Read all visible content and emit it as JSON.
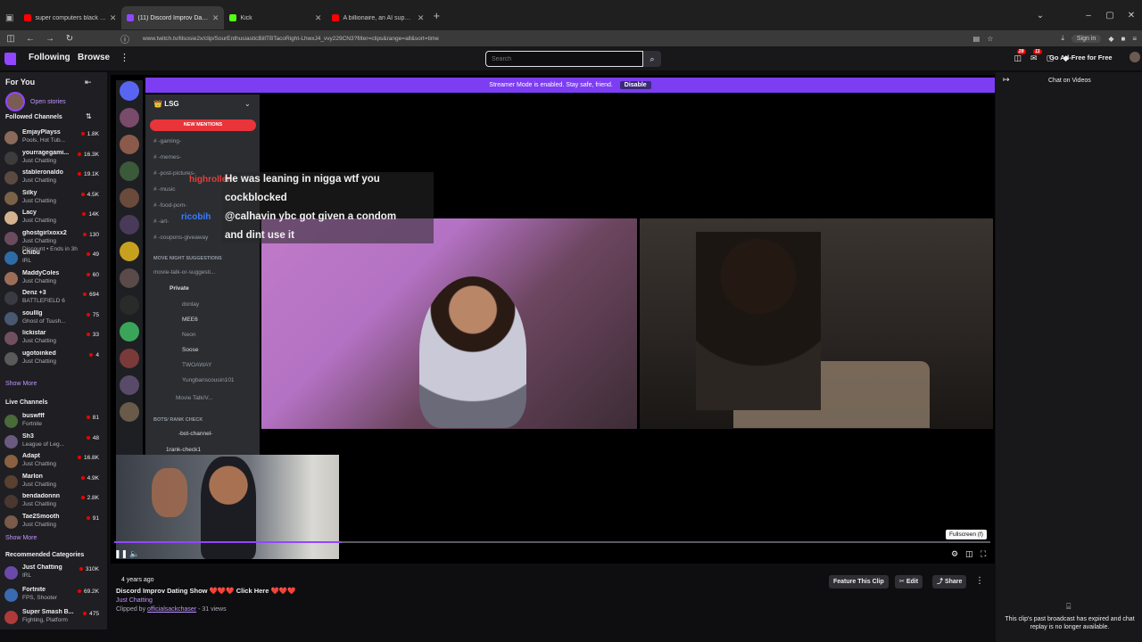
{
  "browser": {
    "tabs": [
      {
        "label": "super computers black commu",
        "color": "#ff0000",
        "active": false
      },
      {
        "label": "(11) Discord Improv Dating",
        "color": "#9147ff",
        "active": true
      },
      {
        "label": "Kick",
        "color": "#53fc18",
        "active": false
      },
      {
        "label": "A billionaire, an AI supercomp",
        "color": "#ff0000",
        "active": false
      }
    ],
    "url": "www.twitch.tv/lilsosie2x/clip/SourEnthusiasticBillTBTacoRight-LhwxJ4_vvy229CN3?filter=clips&range=all&sort=time",
    "signin_label": "Sign in"
  },
  "topnav": {
    "following": "Following",
    "browse": "Browse",
    "search_placeholder": "Search",
    "notif_badge": "28",
    "inbox_badge": "11",
    "adfree": "Go Ad-Free for Free"
  },
  "sidebar": {
    "for_you": "For You",
    "open_stories": "Open stories",
    "followed_header": "Followed Channels",
    "followed": [
      {
        "name": "EmjayPlayss",
        "game": "Pools, Hot Tub...",
        "viewers": "1.8K",
        "color": "#8a6a5a"
      },
      {
        "name": "yourragegami...",
        "game": "Just Chatting",
        "viewers": "16.3K",
        "color": "#3c3c3c"
      },
      {
        "name": "stableronaldo",
        "game": "Just Chatting",
        "viewers": "19.1K",
        "color": "#5a4a42"
      },
      {
        "name": "Silky",
        "game": "Just Chatting",
        "viewers": "4.5K",
        "color": "#7a6248"
      },
      {
        "name": "Lacy",
        "game": "Just Chatting",
        "viewers": "14K",
        "color": "#d4b390"
      },
      {
        "name": "ghostgirlxoxx2",
        "game": "Just Chatting",
        "viewers": "130",
        "color": "#6b4c5e"
      },
      {
        "name": "Chibu",
        "game": "IRL",
        "viewers": "49",
        "color": "#2e6ca8"
      },
      {
        "name": "MaddyColes",
        "game": "Just Chatting",
        "viewers": "60",
        "color": "#9c6e58"
      },
      {
        "name": "Denz +3",
        "game": "BATTLEFIELD 6",
        "viewers": "694",
        "color": "#3a3a44"
      },
      {
        "name": "soulllg",
        "game": "Ghost of Tsush...",
        "viewers": "75",
        "color": "#485870"
      },
      {
        "name": "lickistar",
        "game": "Just Chatting",
        "viewers": "33",
        "color": "#705060"
      },
      {
        "name": "ugotoinked",
        "game": "Just Chatting",
        "viewers": "4",
        "color": "#5a5a5a"
      }
    ],
    "discount_line": "Discount • Ends in 3h",
    "show_more": "Show More",
    "live_header": "Live Channels",
    "live": [
      {
        "name": "buswfff",
        "game": "Fortnite",
        "viewers": "81",
        "color": "#4a6a3a"
      },
      {
        "name": "Sh3",
        "game": "League of Leg...",
        "viewers": "48",
        "color": "#6a5a80"
      },
      {
        "name": "Adapt",
        "game": "Just Chatting",
        "viewers": "16.8K",
        "color": "#8a6040"
      },
      {
        "name": "Marlon",
        "game": "Just Chatting",
        "viewers": "4.9K",
        "color": "#5a4030"
      },
      {
        "name": "bendadonnn",
        "game": "Just Chatting",
        "viewers": "2.8K",
        "color": "#4a3830"
      },
      {
        "name": "Tae2Smooth",
        "game": "Just Chatting",
        "viewers": "91",
        "color": "#7a5a4a"
      }
    ],
    "show_more_2": "Show More",
    "rec_header": "Recommended Categories",
    "categories": [
      {
        "name": "Just Chatting",
        "game": "IRL",
        "viewers": "310K",
        "color": "#6a4aa8"
      },
      {
        "name": "Fortnite",
        "game": "FPS, Shooter",
        "viewers": "69.2K",
        "color": "#3a6ab0"
      },
      {
        "name": "Super Smash B...",
        "game": "Fighting, Platform",
        "viewers": "475",
        "color": "#b03a3a"
      }
    ]
  },
  "player": {
    "banner_text": "Streamer Mode is enabled. Stay safe, friend.",
    "banner_button": "Disable",
    "tooltip": "Fullscreen (f)",
    "progress": 0.26
  },
  "discord": {
    "server": "LSG",
    "new_mentions": "NEW MENTIONS",
    "rows": [
      {
        "text": "-gaming-",
        "bright": false
      },
      {
        "text": "-memes-",
        "bright": false
      },
      {
        "text": "-post-pictures-",
        "bright": false
      },
      {
        "text": "-music",
        "bright": false
      },
      {
        "text": "-food-porn-",
        "bright": false
      },
      {
        "text": "-art-",
        "bright": false
      },
      {
        "text": "-coupons-giveaway",
        "bright": false
      }
    ],
    "cat_movie": "MOVE NIGHT SUGGESTIONS",
    "movie_row": "movie-talk-or-suggesti...",
    "private_row": "Private",
    "users": [
      {
        "text": "donlay"
      },
      {
        "text": "MEE6"
      },
      {
        "text": "Neon"
      },
      {
        "text": "Soose"
      },
      {
        "text": "TWOAWAY"
      },
      {
        "text": "Yungbanscousin101"
      }
    ],
    "movie_talk": "Movie Talk/V...",
    "cat_bots": "BOTS/ RANK CHECK",
    "bot_channel": "-bot-channel-",
    "rank_check": "1rank-check1"
  },
  "chat_overlay": {
    "user1": "highroller",
    "msg1_a": "He was leaning in nigga wtf you",
    "msg1_b": "cockblocked",
    "user2": "ricobih",
    "msg2_a": "@calhavin ybc got given a condom",
    "msg2_b": "and dint use it"
  },
  "clip": {
    "time_ago": "4 years ago",
    "title": "Discord Improv Dating Show ❤️❤️❤️ Click Here ❤️❤️❤️",
    "category": "Just Chatting",
    "clipped_prefix": "Clipped by",
    "clipped_by": "officialsackchaser",
    "views": " - 31 views",
    "feature": "Feature This Clip",
    "edit": "Edit",
    "share": "Share"
  },
  "right": {
    "title": "Chat on Videos",
    "expired": "This clip's past broadcast has expired and chat replay is no longer available."
  }
}
